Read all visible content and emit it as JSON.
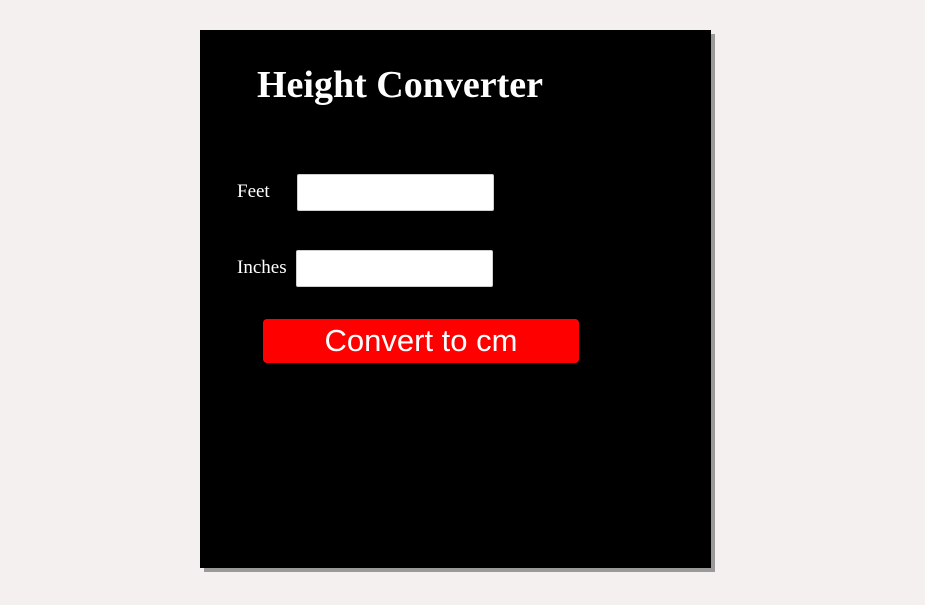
{
  "colors": {
    "page_background": "#f4f0ef",
    "panel_background": "#000000",
    "panel_shadow": "#9a9a9a",
    "text": "#ffffff",
    "button_background": "#ff0000"
  },
  "converter": {
    "title": "Height Converter",
    "feet": {
      "label": "Feet",
      "value": ""
    },
    "inches": {
      "label": "Inches",
      "value": ""
    },
    "convert_button_label": "Convert to cm"
  }
}
